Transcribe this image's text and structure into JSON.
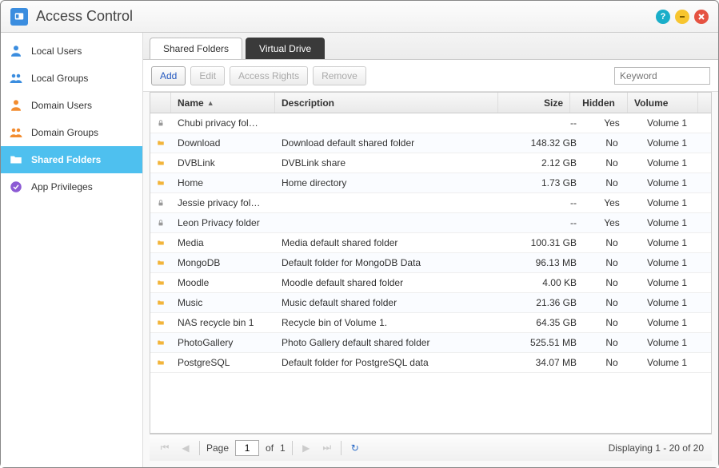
{
  "window": {
    "title": "Access Control"
  },
  "sidebar": {
    "items": [
      {
        "label": "Local Users",
        "icon": "user",
        "color": "#3b8ddf"
      },
      {
        "label": "Local Groups",
        "icon": "group",
        "color": "#3b8ddf"
      },
      {
        "label": "Domain Users",
        "icon": "user",
        "color": "#f28c2f"
      },
      {
        "label": "Domain Groups",
        "icon": "group",
        "color": "#f28c2f"
      },
      {
        "label": "Shared Folders",
        "icon": "folder",
        "active": true
      },
      {
        "label": "App Privileges",
        "icon": "app",
        "color": "#8c5ad4"
      }
    ]
  },
  "tabs": [
    {
      "label": "Shared Folders",
      "active": true
    },
    {
      "label": "Virtual Drive",
      "active": false
    }
  ],
  "toolbar": {
    "add": "Add",
    "edit": "Edit",
    "rights": "Access Rights",
    "remove": "Remove",
    "search_placeholder": "Keyword"
  },
  "columns": {
    "name": "Name",
    "desc": "Description",
    "size": "Size",
    "hidden": "Hidden",
    "volume": "Volume"
  },
  "rows": [
    {
      "icon": "lock",
      "name": "Chubi privacy fol…",
      "desc": "",
      "size": "--",
      "hidden": "Yes",
      "volume": "Volume 1"
    },
    {
      "icon": "folder",
      "name": "Download",
      "desc": "Download default shared folder",
      "size": "148.32 GB",
      "hidden": "No",
      "volume": "Volume 1"
    },
    {
      "icon": "folder",
      "name": "DVBLink",
      "desc": "DVBLink share",
      "size": "2.12 GB",
      "hidden": "No",
      "volume": "Volume 1"
    },
    {
      "icon": "folder",
      "name": "Home",
      "desc": "Home directory",
      "size": "1.73 GB",
      "hidden": "No",
      "volume": "Volume 1"
    },
    {
      "icon": "lock",
      "name": "Jessie privacy fol…",
      "desc": "",
      "size": "--",
      "hidden": "Yes",
      "volume": "Volume 1"
    },
    {
      "icon": "lock",
      "name": "Leon Privacy folder",
      "desc": "",
      "size": "--",
      "hidden": "Yes",
      "volume": "Volume 1"
    },
    {
      "icon": "folder",
      "name": "Media",
      "desc": "Media default shared folder",
      "size": "100.31 GB",
      "hidden": "No",
      "volume": "Volume 1"
    },
    {
      "icon": "folder",
      "name": "MongoDB",
      "desc": "Default folder for MongoDB Data",
      "size": "96.13 MB",
      "hidden": "No",
      "volume": "Volume 1"
    },
    {
      "icon": "folder",
      "name": "Moodle",
      "desc": "Moodle default shared folder",
      "size": "4.00 KB",
      "hidden": "No",
      "volume": "Volume 1"
    },
    {
      "icon": "folder",
      "name": "Music",
      "desc": "Music default shared folder",
      "size": "21.36 GB",
      "hidden": "No",
      "volume": "Volume 1"
    },
    {
      "icon": "folder",
      "name": "NAS recycle bin 1",
      "desc": "Recycle bin of Volume 1.",
      "size": "64.35 GB",
      "hidden": "No",
      "volume": "Volume 1"
    },
    {
      "icon": "folder",
      "name": "PhotoGallery",
      "desc": "Photo Gallery default shared folder",
      "size": "525.51 MB",
      "hidden": "No",
      "volume": "Volume 1"
    },
    {
      "icon": "folder",
      "name": "PostgreSQL",
      "desc": "Default folder for PostgreSQL data",
      "size": "34.07 MB",
      "hidden": "No",
      "volume": "Volume 1"
    }
  ],
  "pager": {
    "page_label": "Page",
    "page": "1",
    "of_label": "of",
    "total_pages": "1",
    "display": "Displaying 1 - 20 of 20"
  }
}
